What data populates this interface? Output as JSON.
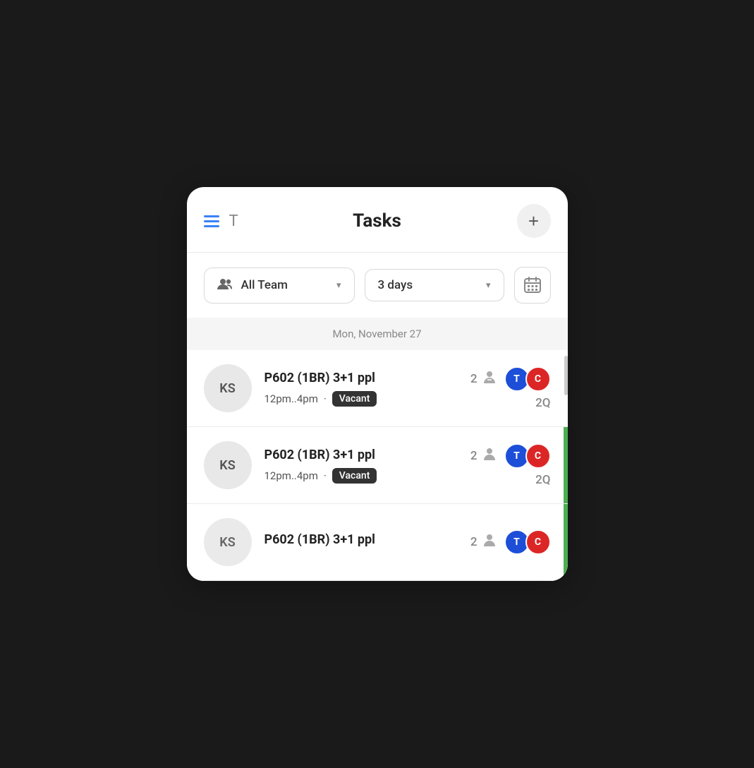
{
  "header": {
    "title": "Tasks",
    "t_label": "T",
    "add_label": "+"
  },
  "filters": {
    "team_label": "All Team",
    "team_icon": "👥",
    "days_label": "3 days",
    "calendar_icon": "📅"
  },
  "date_section": {
    "date_label": "Mon, November 27"
  },
  "tasks": [
    {
      "id": "task-1",
      "avatar_initials": "KS",
      "title": "P602 (1BR) 3+1 ppl",
      "time": "12pm..4pm",
      "status": "Vacant",
      "count": "2",
      "members": [
        {
          "initials": "T",
          "color": "blue"
        },
        {
          "initials": "C",
          "color": "red"
        }
      ],
      "qty": "2Q",
      "has_green_bar": false
    },
    {
      "id": "task-2",
      "avatar_initials": "KS",
      "title": "P602 (1BR) 3+1 ppl",
      "time": "12pm..4pm",
      "status": "Vacant",
      "count": "2",
      "members": [
        {
          "initials": "T",
          "color": "blue"
        },
        {
          "initials": "C",
          "color": "red"
        }
      ],
      "qty": "2Q",
      "has_green_bar": true
    },
    {
      "id": "task-3",
      "avatar_initials": "KS",
      "title": "P602 (1BR) 3+1 ppl",
      "time": "",
      "status": "",
      "count": "2",
      "members": [
        {
          "initials": "T",
          "color": "blue"
        },
        {
          "initials": "C",
          "color": "red"
        }
      ],
      "qty": "",
      "has_green_bar": true
    }
  ]
}
